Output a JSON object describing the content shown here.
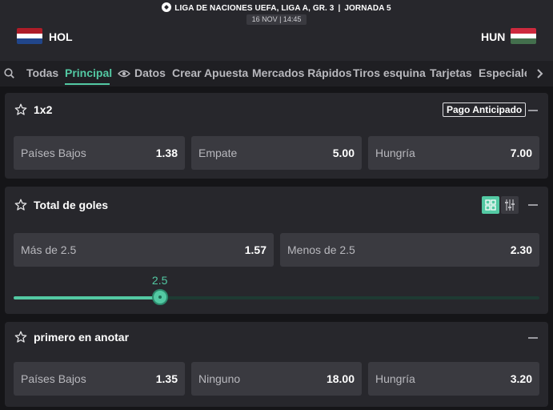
{
  "header": {
    "competition": "LIGA DE NACIONES UEFA, LIGA A, GR. 3",
    "separator": "|",
    "matchday": "JORNADA  5",
    "datetime": "16 NOV | 14:45",
    "home": {
      "code": "HOL",
      "flag_colors": [
        "#ae1c28",
        "#ffffff",
        "#21468b"
      ]
    },
    "away": {
      "code": "HUN",
      "flag_colors": [
        "#cd2a3e",
        "#ffffff",
        "#436f4d"
      ]
    }
  },
  "tabs": {
    "items": [
      "Todas",
      "Principal",
      "Datos",
      "Crear Apuesta",
      "Mercados Rápidos",
      "Tiros esquina",
      "Tarjetas",
      "Especiale"
    ],
    "active": "Principal"
  },
  "markets": {
    "m1x2": {
      "title": "1x2",
      "badge": "Pago Anticipado",
      "odds": [
        {
          "label": "Países Bajos",
          "value": "1.38"
        },
        {
          "label": "Empate",
          "value": "5.00"
        },
        {
          "label": "Hungría",
          "value": "7.00"
        }
      ]
    },
    "total_goals": {
      "title": "Total de goles",
      "odds": [
        {
          "label": "Más de 2.5",
          "value": "1.57"
        },
        {
          "label": "Menos de 2.5",
          "value": "2.30"
        }
      ],
      "slider": {
        "value": "2.5",
        "fraction": 0.278
      }
    },
    "first_scorer": {
      "title": "primero en anotar",
      "odds": [
        {
          "label": "Países Bajos",
          "value": "1.35"
        },
        {
          "label": "Ninguno",
          "value": "18.00"
        },
        {
          "label": "Hungría",
          "value": "3.20"
        }
      ]
    }
  },
  "colors": {
    "accent": "#53c9a3",
    "card": "#27272c",
    "odd_button": "#3a3a40"
  },
  "icons": [
    "soccer-ball-icon",
    "search-icon",
    "eye-icon",
    "chevron-right-icon",
    "star-icon",
    "collapse-icon",
    "grid-view-icon",
    "sliders-view-icon"
  ]
}
